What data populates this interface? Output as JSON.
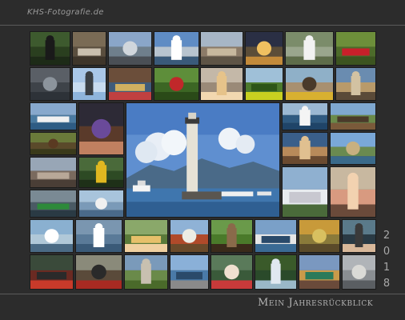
{
  "header": {
    "watermark": "KHS-Fotografie.de"
  },
  "footer": {
    "title": "Mein Jahresrückblick"
  },
  "year_digits": [
    "2",
    "0",
    "1",
    "8"
  ],
  "colors": {
    "background": "#2c2c2c",
    "rule": "#5a5a5a",
    "text": "#b3b3b3"
  },
  "collage": {
    "center_photo": "lighthouse-harbor",
    "photos": [
      "portrait-man-suit",
      "couple-on-street",
      "vintage-vw-bus",
      "cruise-ship-harbor",
      "old-town-houses",
      "city-night-lights",
      "seagull",
      "red-vintage-car",
      "storm-clouds-lake",
      "airplane-sky",
      "love-locks",
      "red-convertible",
      "blonde-woman-portrait",
      "park-trees",
      "yellow-tram",
      "half-timbered-street",
      "lake-ferry",
      "curly-hair-woman",
      "cruise-ship-white",
      "windmill",
      "brown-bear",
      "castle-village",
      "harbor-town",
      "river-town",
      "parrots",
      "hilltop-castle",
      "harbor-pier",
      "woman-portrait",
      "green-boat",
      "boats-dock",
      "car-ferry",
      "blonde-woman-green",
      "timber-house",
      "old-cannon",
      "passenger-ship",
      "market-square",
      "man-with-microphone",
      "red-tractor-car",
      "red-steam-tractor",
      "garden-pavilion",
      "modern-buildings",
      "red-jacket-man",
      "waterfall-forest",
      "colorful-old-town",
      "cathedral-square",
      "man-with-hat"
    ]
  }
}
